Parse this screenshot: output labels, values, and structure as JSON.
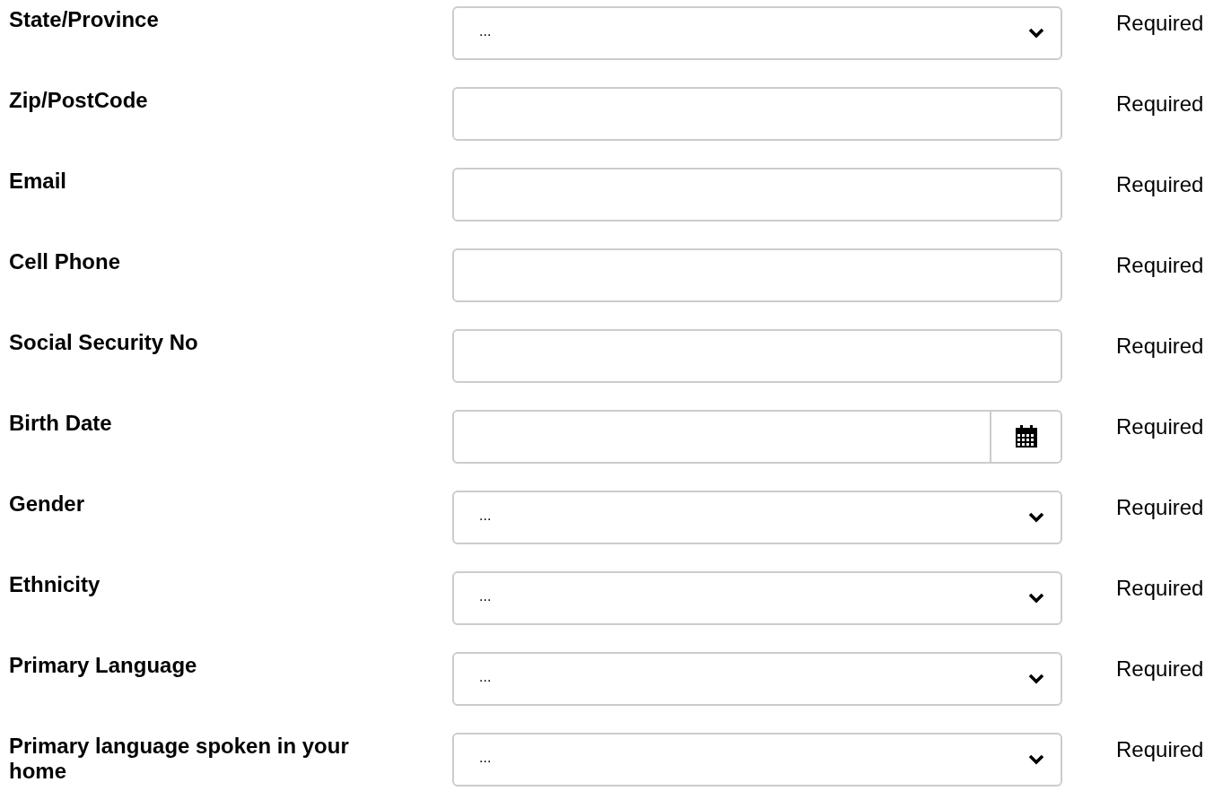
{
  "fields": [
    {
      "label": "State/Province",
      "kind": "select",
      "value": "...",
      "note": "Required"
    },
    {
      "label": "Zip/PostCode",
      "kind": "text",
      "note": "Required"
    },
    {
      "label": "Email",
      "kind": "text",
      "note": "Required"
    },
    {
      "label": "Cell Phone",
      "kind": "text",
      "note": "Required"
    },
    {
      "label": "Social Security No",
      "kind": "text",
      "note": "Required"
    },
    {
      "label": "Birth Date",
      "kind": "date",
      "note": "Required"
    },
    {
      "label": "Gender",
      "kind": "select",
      "value": "...",
      "note": "Required"
    },
    {
      "label": "Ethnicity",
      "kind": "select",
      "value": "...",
      "note": "Required"
    },
    {
      "label": "Primary Language",
      "kind": "select",
      "value": "...",
      "note": "Required"
    },
    {
      "label": "Primary language spoken in your home",
      "kind": "select",
      "value": "...",
      "note": "Required"
    }
  ]
}
